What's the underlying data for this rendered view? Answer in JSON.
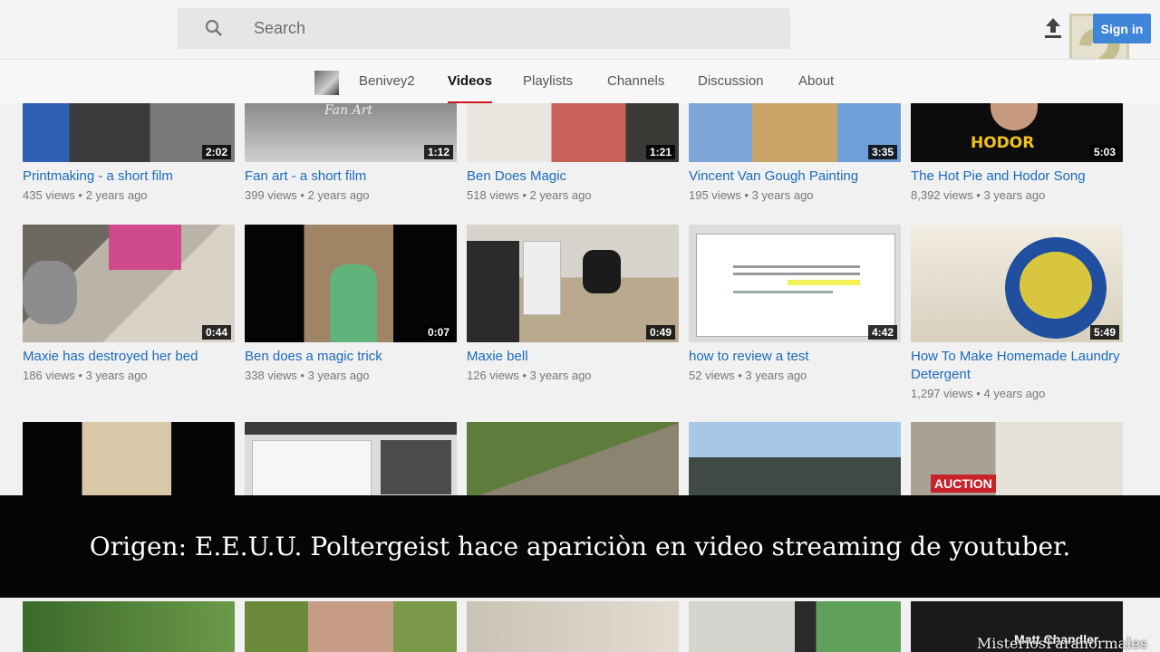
{
  "header": {
    "search_placeholder": "Search",
    "sign_in_label": "Sign in",
    "logo_badge": "2"
  },
  "channel": {
    "tabs": [
      {
        "label": "Benivey2"
      },
      {
        "label": "Videos"
      },
      {
        "label": "Playlists"
      },
      {
        "label": "Channels"
      },
      {
        "label": "Discussion"
      },
      {
        "label": "About"
      }
    ],
    "active_tab": "Videos",
    "accent_color": "#cc181e"
  },
  "videos": {
    "row1": [
      {
        "title": "Printmaking - a short film",
        "views": "435 views",
        "age": "2 years ago",
        "duration": "2:02"
      },
      {
        "title": "Fan art - a short film",
        "views": "399 views",
        "age": "2 years ago",
        "duration": "1:12"
      },
      {
        "title": "Ben Does Magic",
        "views": "518 views",
        "age": "2 years ago",
        "duration": "1:21"
      },
      {
        "title": "Vincent Van Gough Painting",
        "views": "195 views",
        "age": "3 years ago",
        "duration": "3:35"
      },
      {
        "title": "The Hot Pie and Hodor Song",
        "views": "8,392 views",
        "age": "3 years ago",
        "duration": "5:03"
      }
    ],
    "row2": [
      {
        "title": "Maxie has destroyed her bed",
        "views": "186 views",
        "age": "3 years ago",
        "duration": "0:44"
      },
      {
        "title": "Ben does a magic trick",
        "views": "338 views",
        "age": "3 years ago",
        "duration": "0:07"
      },
      {
        "title": "Maxie bell",
        "views": "126 views",
        "age": "3 years ago",
        "duration": "0:49"
      },
      {
        "title": "how to review a test",
        "views": "52 views",
        "age": "3 years ago",
        "duration": "4:42"
      },
      {
        "title": "How To Make Homemade Laundry Detergent",
        "views": "1,297 views",
        "age": "4 years ago",
        "duration": "5:49"
      }
    ],
    "thumb_text": {
      "fan_art_overlay": "Fan Art",
      "hodor_label": "HODOR",
      "auction_sign": "AUCTION",
      "chandler_text": "Matt Chandler"
    }
  },
  "overlay": {
    "caption": "Origen: E.E.U.U. Poltergeist hace apariciòn en video streaming de youtuber.",
    "watermark": "MisteriosParanormales"
  }
}
